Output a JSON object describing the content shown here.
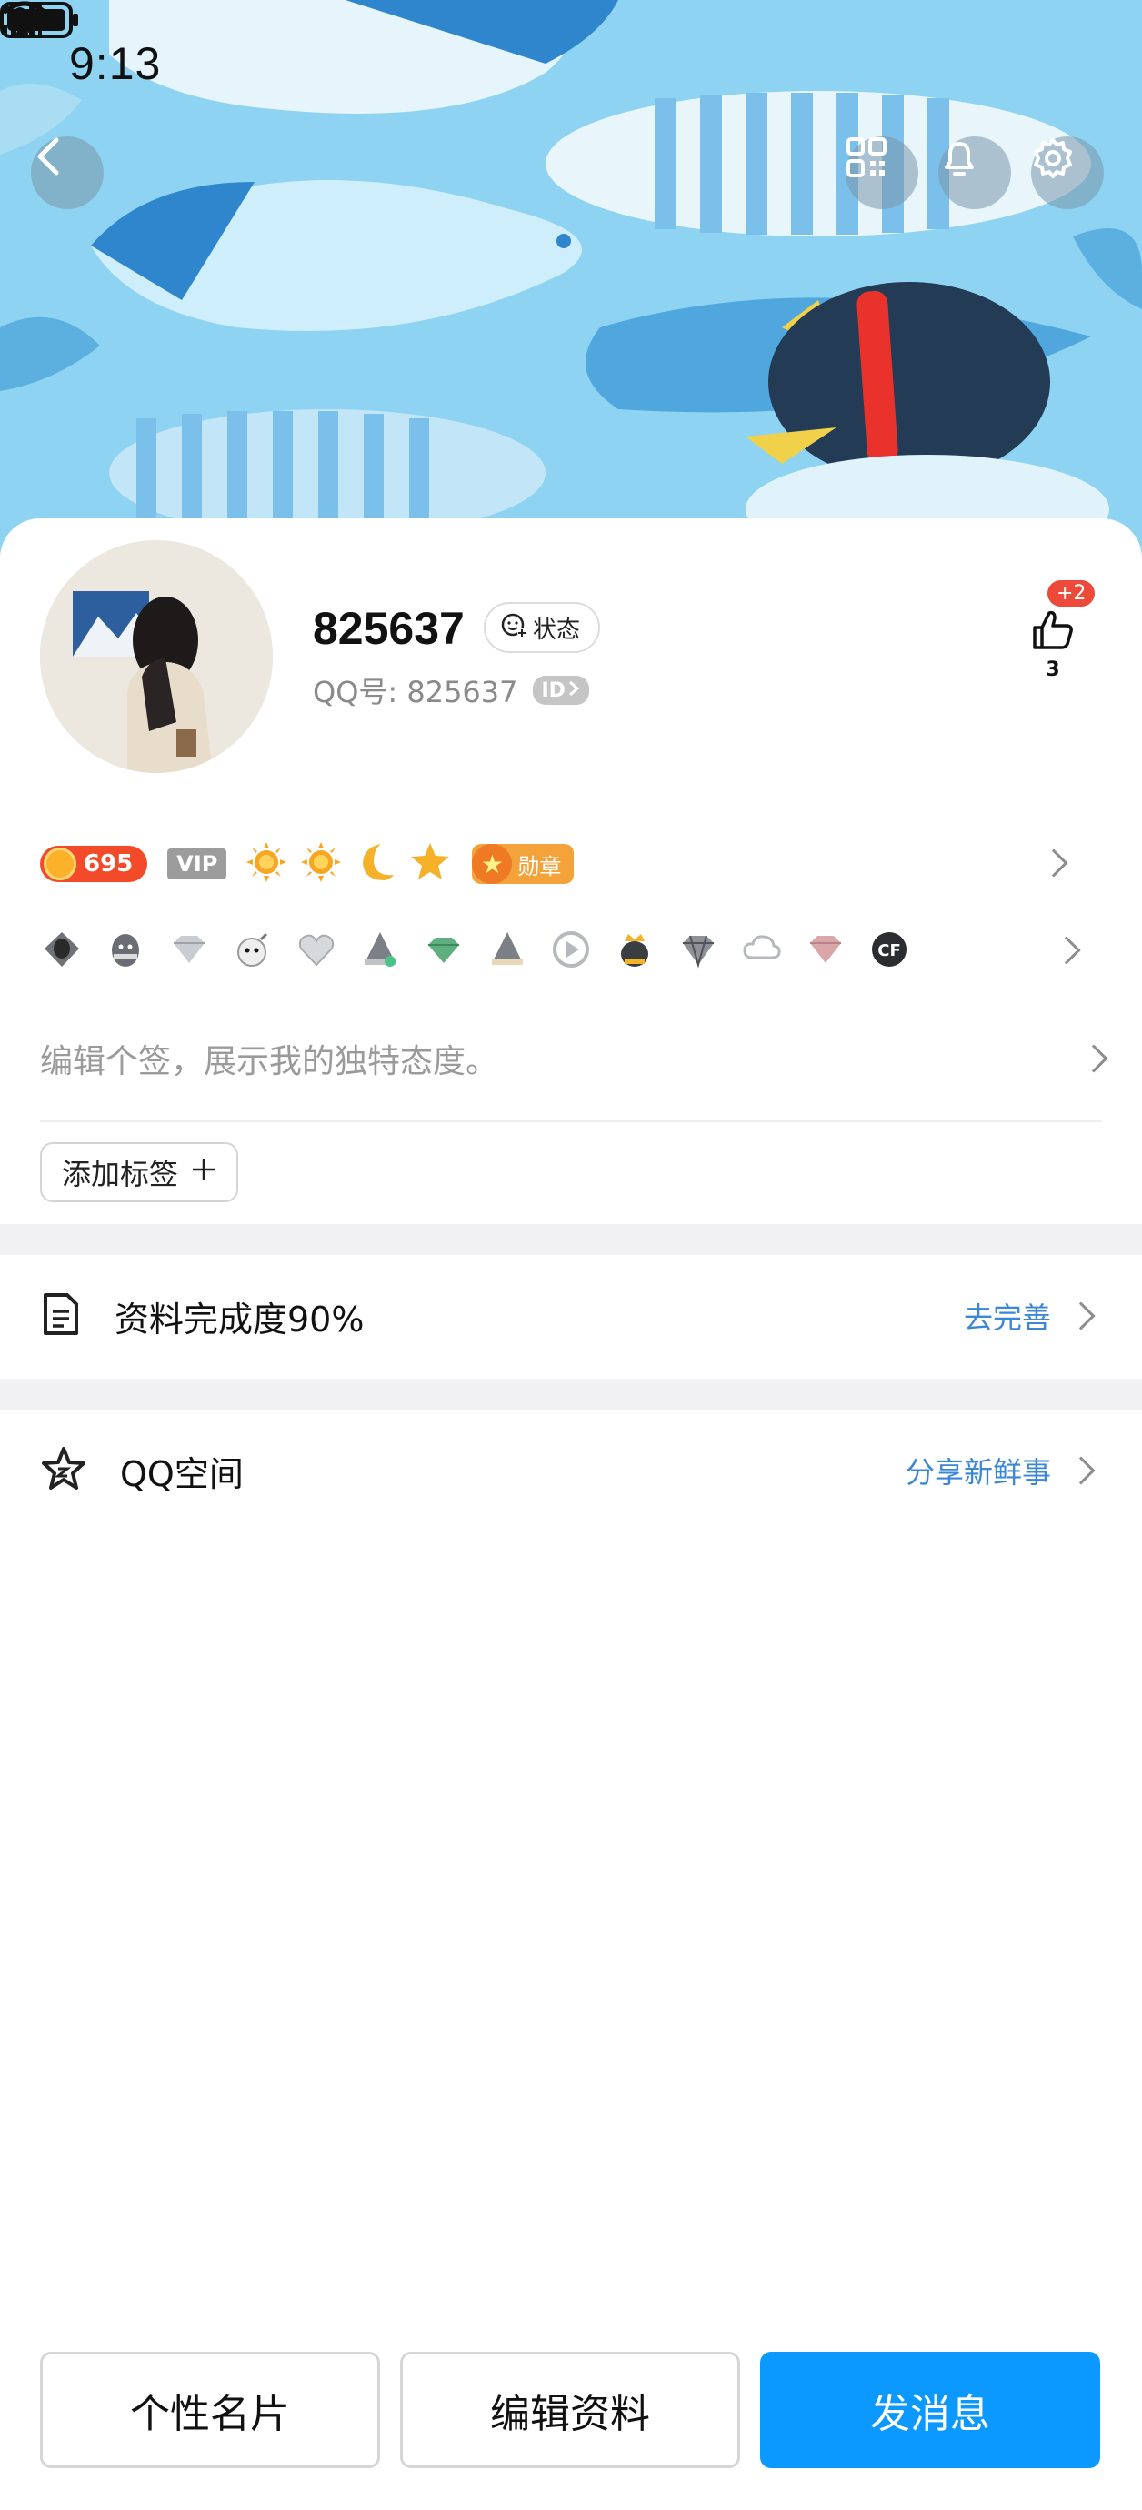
{
  "status_bar": {
    "time": "9:13",
    "icons": [
      "bell-muted-icon",
      "wifi-icon",
      "signal-icon",
      "signal-icon",
      "battery-icon"
    ]
  },
  "header": {
    "back_icon": "chevron-left-icon",
    "actions": [
      "qr-code-icon",
      "bell-icon",
      "gear-icon"
    ]
  },
  "profile": {
    "nickname": "825637",
    "state_label": "状态",
    "qq_label": "QQ号:",
    "qq_number": "825637",
    "id_badge": "ID",
    "likes": {
      "plus": "+2",
      "count": "3"
    }
  },
  "levels": {
    "coin_value": "695",
    "vip_label": "VIP",
    "level_icons": [
      "sun-icon",
      "sun-icon",
      "moon-icon",
      "star-icon"
    ],
    "medal_label": "勋章"
  },
  "badges": [
    "diamond-penguin-icon",
    "penguin-icon",
    "diamond-icon",
    "bomb-icon",
    "heart-icon",
    "penguin-hat-icon",
    "green-diamond-icon",
    "penguin-hat-icon",
    "play-icon",
    "crown-penguin-icon",
    "black-diamond-icon",
    "cloud-icon",
    "pink-diamond-icon",
    "cf-icon"
  ],
  "signature": {
    "placeholder": "编辑个签，展示我的独特态度。"
  },
  "tags": {
    "add_label": "添加标签"
  },
  "rows": {
    "completion": {
      "icon": "document-icon",
      "label": "资料完成度90%",
      "action": "去完善"
    },
    "qzone": {
      "icon": "star-outline-icon",
      "label": "QQ空间",
      "action": "分享新鲜事"
    }
  },
  "bottom_buttons": {
    "card": "个性名片",
    "edit": "编辑资料",
    "message": "发消息"
  },
  "colors": {
    "banner_bg": "#8fd3f2",
    "primary": "#0c99ff",
    "link": "#3b86d6",
    "coin": "#f34b2a"
  }
}
